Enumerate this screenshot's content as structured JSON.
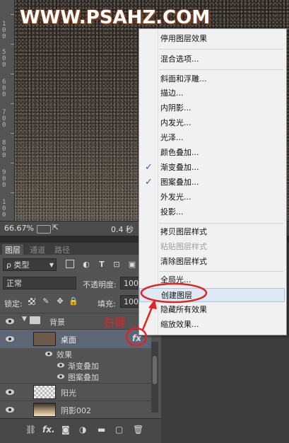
{
  "watermark": "WWW.PSAHZ.COM",
  "ruler_labels": [
    "1",
    "0",
    "0",
    "5",
    "0",
    "0",
    "6",
    "0",
    "0",
    "7",
    "0",
    "0",
    "8",
    "0",
    "0",
    "9",
    "0",
    "0",
    "1",
    "0",
    "0"
  ],
  "status": {
    "zoom": "66.67%",
    "time": "0.4 秒"
  },
  "layers_panel": {
    "tabs": [
      "图层",
      "通道",
      "路径"
    ],
    "filter_kind": "ρ 类型",
    "blend_mode": "正常",
    "opacity_label": "不透明度:",
    "opacity_value": "100",
    "lock_label": "锁定:",
    "fill_label": "填充:",
    "fill_value": "100",
    "group_name": "背景",
    "layers": [
      {
        "name": "桌面",
        "fx": "fx",
        "effects_label": "效果",
        "effects": [
          "渐变叠加",
          "图案叠加"
        ]
      },
      {
        "name": "阳光"
      },
      {
        "name": "阴影002"
      }
    ],
    "bottom_icons": [
      "link-icon",
      "fx-icon",
      "mask-icon",
      "adjustment-icon",
      "folder-icon",
      "new-layer-icon",
      "trash-icon"
    ],
    "bottom_fx": "fx."
  },
  "context_menu": {
    "items": [
      {
        "label": "停用图层效果"
      },
      {
        "label": "混合选项..."
      },
      {
        "label": "斜面和浮雕..."
      },
      {
        "label": "描边..."
      },
      {
        "label": "内阴影..."
      },
      {
        "label": "内发光..."
      },
      {
        "label": "光泽..."
      },
      {
        "label": "颜色叠加..."
      },
      {
        "label": "渐变叠加...",
        "checked": true
      },
      {
        "label": "图案叠加...",
        "checked": true
      },
      {
        "label": "外发光..."
      },
      {
        "label": "投影..."
      },
      {
        "label": "拷贝图层样式"
      },
      {
        "label": "粘贴图层样式",
        "disabled": true
      },
      {
        "label": "清除图层样式"
      },
      {
        "label": "全局光..."
      },
      {
        "label": "创建图层",
        "highlighted": true
      },
      {
        "label": "隐藏所有效果"
      },
      {
        "label": "缩放效果..."
      }
    ],
    "checkmark": "✓"
  },
  "annotation": {
    "text": "右键",
    "color": "#e12323"
  }
}
